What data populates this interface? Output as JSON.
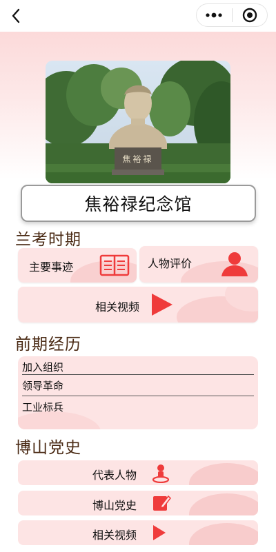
{
  "hall_name": "焦裕禄纪念馆",
  "statue_plaque": "焦裕禄",
  "sections": {
    "lankao": {
      "title": "兰考时期",
      "main_deeds": "主要事迹",
      "evaluation": "人物评价",
      "videos": "相关视频"
    },
    "early": {
      "title": "前期经历",
      "items": [
        "加入组织",
        "领导革命",
        "工业标兵"
      ]
    },
    "boshan": {
      "title": "博山党史",
      "items": [
        "代表人物",
        "博山党史",
        "相关视频"
      ]
    }
  },
  "colors": {
    "accent": "#ef3b3b",
    "card_bg": "#fde4e4",
    "section_title": "#4a2a14"
  },
  "icons": {
    "back": "chevron-left-icon",
    "more": "more-dots-icon",
    "close": "target-close-icon",
    "book": "book-icon",
    "person": "person-icon",
    "play": "play-icon",
    "map_person": "person-location-icon",
    "edit_doc": "edit-document-icon"
  }
}
